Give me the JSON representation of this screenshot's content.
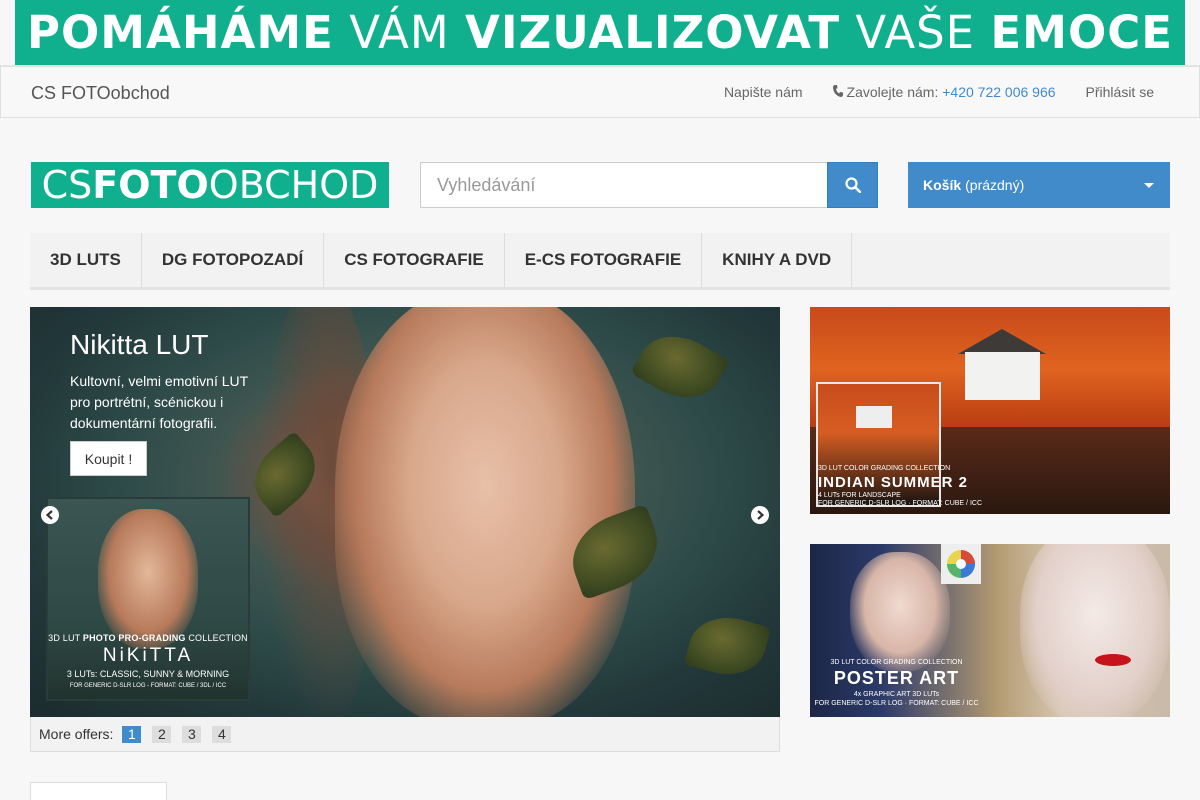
{
  "banner": {
    "word1": "POMÁHÁME",
    "word2": "VÁM",
    "word3": "VIZUALIZOVAT",
    "word4": "VAŠE",
    "word5": "EMOCE",
    "color": "#10b08f"
  },
  "topnav": {
    "brand": "CS FOTOobchod",
    "write_us": "Napište nám",
    "call_label": "Zavolejte nám:",
    "phone": "+420 722 006 966",
    "login": "Přihlásit se"
  },
  "header": {
    "logo_light1": "CS ",
    "logo_bold": "FOTO",
    "logo_light2": "OBCHOD",
    "search_placeholder": "Vyhledávání",
    "cart_label": "Košík",
    "cart_status": "(prázdný)",
    "accent": "#428bca"
  },
  "categories": [
    {
      "label": "3D LUTS"
    },
    {
      "label": "DG FOTOPOZADÍ"
    },
    {
      "label": "CS FOTOGRAFIE"
    },
    {
      "label": "E-CS FOTOGRAFIE"
    },
    {
      "label": "KNIHY A DVD"
    }
  ],
  "slider": {
    "title": "Nikitta LUT",
    "description": "Kultovní, velmi emotivní LUT pro portrétní, scénickou i dokumentární fotografii.",
    "button": "Koupit !",
    "product": {
      "line1_a": "3D LUT ",
      "line1_b": "PHOTO PRO-GRADING",
      "line1_c": " COLLECTION",
      "name": "NiKiTTA",
      "line3": "3 LUTs: CLASSIC, SUNNY & MORNING",
      "line4": "FOR GENERIC D-SLR LOG - FORMAT: CUBE / 3DL / ICC"
    }
  },
  "pager": {
    "label": "More offers:",
    "pages": [
      "1",
      "2",
      "3",
      "4"
    ],
    "active": "1"
  },
  "side_banners": {
    "indian": {
      "l1": "3D LUT COLOR GRADING COLLECTION",
      "l2": "INDIAN SUMMER 2",
      "l3": "4 LUTs FOR LANDSCAPE",
      "l4": "FOR GENERIC D-SLR LOG · FORMAT: CUBE / ICC"
    },
    "poster": {
      "l1": "3D LUT COLOR GRADING COLLECTION",
      "l2": "POSTER ART",
      "l3": "4x GRAPHIC ART 3D LUTs",
      "l4": "FOR GENERIC D-SLR LOG · FORMAT: CUBE / ICC"
    }
  }
}
